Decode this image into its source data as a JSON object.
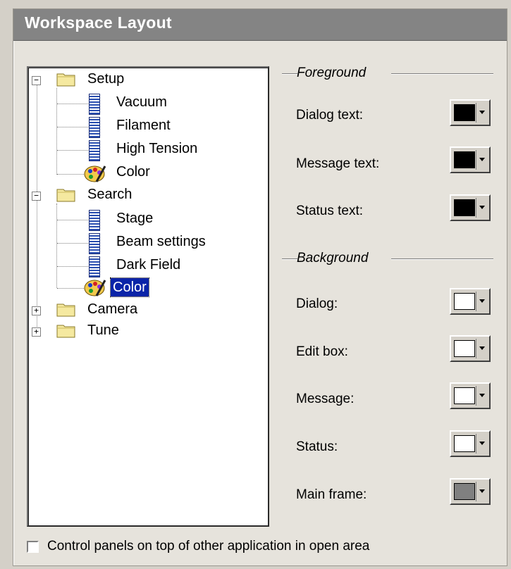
{
  "window": {
    "title": "Workspace Layout"
  },
  "tree": {
    "nodes": [
      {
        "label": "Setup",
        "icon": "folder-icon",
        "expander": "−"
      },
      {
        "label": "Vacuum",
        "icon": "document-icon"
      },
      {
        "label": "Filament",
        "icon": "document-icon"
      },
      {
        "label": "High Tension",
        "icon": "document-icon"
      },
      {
        "label": "Color",
        "icon": "palette-icon"
      },
      {
        "label": "Search",
        "icon": "folder-icon",
        "expander": "−"
      },
      {
        "label": "Stage",
        "icon": "document-icon"
      },
      {
        "label": "Beam settings",
        "icon": "document-icon"
      },
      {
        "label": "Dark Field",
        "icon": "document-icon"
      },
      {
        "label": "Color",
        "icon": "palette-icon",
        "selected": true
      },
      {
        "label": "Camera",
        "icon": "folder-icon",
        "expander": "+"
      },
      {
        "label": "Tune",
        "icon": "folder-icon",
        "expander": "+"
      }
    ]
  },
  "foreground": {
    "title": "Foreground",
    "fields": [
      {
        "label": "Dialog text:",
        "color": "#000000"
      },
      {
        "label": "Message text:",
        "color": "#000000"
      },
      {
        "label": "Status text:",
        "color": "#000000"
      }
    ]
  },
  "background": {
    "title": "Background",
    "fields": [
      {
        "label": "Dialog:",
        "color": "#ffffff"
      },
      {
        "label": "Edit box:",
        "color": "#ffffff"
      },
      {
        "label": "Message:",
        "color": "#ffffff"
      },
      {
        "label": "Status:",
        "color": "#ffffff"
      },
      {
        "label": "Main frame:",
        "color": "#808080"
      }
    ]
  },
  "option": {
    "label": "Control panels on top of other application in open area",
    "checked": false
  }
}
